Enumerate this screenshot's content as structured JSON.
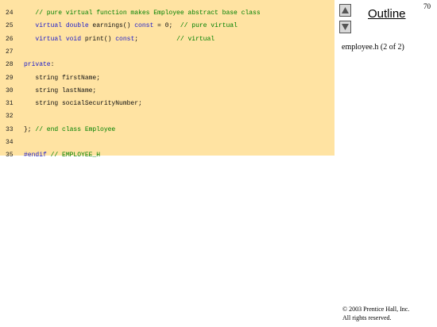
{
  "slide": {
    "outline_label": "Outline",
    "page_number": "70",
    "file_label": "employee.h (2 of 2)",
    "copyright_line1": "© 2003 Prentice Hall, Inc.",
    "copyright_line2": "All rights reserved."
  },
  "nav": {
    "up_icon": "triangle-up-icon",
    "down_icon": "triangle-down-icon"
  },
  "colors": {
    "code_background": "#ffe3a2",
    "comment": "#008000",
    "keyword": "#1a1acc"
  },
  "code": {
    "lines": [
      {
        "num": "24",
        "tokens": [
          {
            "t": "   // pure virtual function makes Employee abstract base class",
            "k": "comment"
          }
        ]
      },
      {
        "num": "25",
        "tokens": [
          {
            "t": "   ",
            "k": "plain"
          },
          {
            "t": "virtual double",
            "k": "keyword"
          },
          {
            "t": " earnings() ",
            "k": "plain"
          },
          {
            "t": "const",
            "k": "keyword"
          },
          {
            "t": " = 0;  ",
            "k": "plain"
          },
          {
            "t": "// pure virtual",
            "k": "comment"
          }
        ]
      },
      {
        "num": "26",
        "tokens": [
          {
            "t": "   ",
            "k": "plain"
          },
          {
            "t": "virtual void",
            "k": "keyword"
          },
          {
            "t": " print() ",
            "k": "plain"
          },
          {
            "t": "const",
            "k": "keyword"
          },
          {
            "t": ";          ",
            "k": "plain"
          },
          {
            "t": "// virtual",
            "k": "comment"
          }
        ]
      },
      {
        "num": "27",
        "tokens": []
      },
      {
        "num": "28",
        "tokens": [
          {
            "t": "private",
            "k": "keyword"
          },
          {
            "t": ":",
            "k": "plain"
          }
        ]
      },
      {
        "num": "29",
        "tokens": [
          {
            "t": "   string firstName;",
            "k": "plain"
          }
        ]
      },
      {
        "num": "30",
        "tokens": [
          {
            "t": "   string lastName;",
            "k": "plain"
          }
        ]
      },
      {
        "num": "31",
        "tokens": [
          {
            "t": "   string socialSecurityNumber;",
            "k": "plain"
          }
        ]
      },
      {
        "num": "32",
        "tokens": []
      },
      {
        "num": "33",
        "tokens": [
          {
            "t": "}; ",
            "k": "plain"
          },
          {
            "t": "// end class Employee",
            "k": "comment"
          }
        ]
      },
      {
        "num": "34",
        "tokens": []
      },
      {
        "num": "35",
        "tokens": [
          {
            "t": "#endif",
            "k": "keyword"
          },
          {
            "t": " ",
            "k": "plain"
          },
          {
            "t": "// EMPLOYEE_H",
            "k": "comment"
          }
        ]
      }
    ]
  }
}
